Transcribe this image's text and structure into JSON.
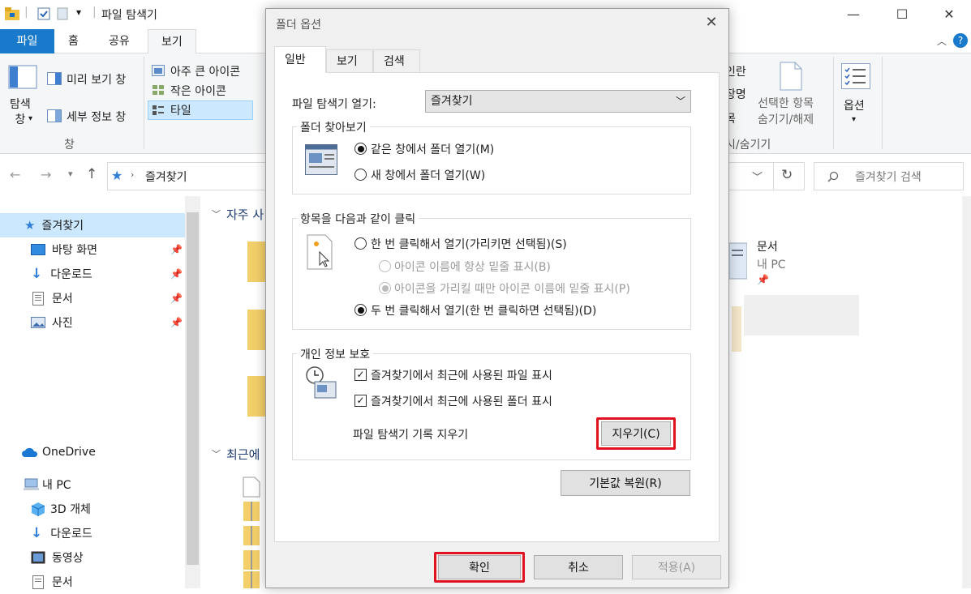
{
  "explorer": {
    "title": "파일 탐색기",
    "tabs": [
      "파일",
      "홈",
      "공유",
      "보기"
    ],
    "ribbon": {
      "nav_pane": "탐색\n창",
      "preview_pane": "미리 보기 창",
      "details_pane": "세부 정보 창",
      "pane_group": "창",
      "layout_xl": "아주 큰 아이콘",
      "layout_small": "작은 아이콘",
      "layout_tiles": "타일",
      "right_top": "인란",
      "right_mid": "장명",
      "right_bot": "목",
      "hide_selected": "선택한 항목\n숨기기/해제",
      "showhide_group": "시/숨기기",
      "options": "옵션"
    },
    "address": "즐겨찾기",
    "search_placeholder": "즐겨찾기 검색",
    "sidebar": [
      {
        "label": "즐겨찾기",
        "icon": "star-icon",
        "pinned": false
      },
      {
        "label": "바탕 화면",
        "icon": "desktop-icon",
        "pinned": true
      },
      {
        "label": "다운로드",
        "icon": "download-icon",
        "pinned": true
      },
      {
        "label": "문서",
        "icon": "document-icon",
        "pinned": true
      },
      {
        "label": "사진",
        "icon": "picture-icon",
        "pinned": true
      },
      {
        "label": "OneDrive",
        "icon": "cloud-icon",
        "pinned": false
      },
      {
        "label": "내 PC",
        "icon": "pc-icon",
        "pinned": false
      },
      {
        "label": "3D 개체",
        "icon": "cube-icon",
        "pinned": false
      },
      {
        "label": "다운로드",
        "icon": "download-icon",
        "pinned": false
      },
      {
        "label": "동영상",
        "icon": "video-icon",
        "pinned": false
      },
      {
        "label": "문서",
        "icon": "document-icon",
        "pinned": false
      }
    ],
    "content": {
      "section_frequent": "자주 사",
      "section_recent": "최근에",
      "doc_tile_name": "문서",
      "doc_tile_sub": "내 PC"
    }
  },
  "dialog": {
    "title": "폴더 옵션",
    "tabs": [
      "일반",
      "보기",
      "검색"
    ],
    "open_label": "파일 탐색기 열기:",
    "open_value": "즐겨찾기",
    "browse": {
      "label": "폴더 찾아보기",
      "same_window": "같은 창에서 폴더 열기(M)",
      "new_window": "새 창에서 폴더 열기(W)"
    },
    "click": {
      "label": "항목을 다음과 같이 클릭",
      "single": "한 번 클릭해서 열기(가리키면 선택됨)(S)",
      "underline_always": "아이콘 이름에 항상 밑줄 표시(B)",
      "underline_hover": "아이콘을 가리킬 때만 아이콘 이름에 밑줄 표시(P)",
      "double": "두 번 클릭해서 열기(한 번 클릭하면 선택됨)(D)"
    },
    "privacy": {
      "label": "개인 정보 보호",
      "recent_files": "즐겨찾기에서 최근에 사용된 파일 표시",
      "recent_folders": "즐겨찾기에서 최근에 사용된 폴더 표시",
      "clear_label": "파일 탐색기 기록 지우기",
      "clear_button": "지우기(C)"
    },
    "restore": "기본값 복원(R)",
    "ok": "확인",
    "cancel": "취소",
    "apply": "적용(A)"
  },
  "colors": {
    "accent": "#1979ca",
    "highlight": "#e1121f",
    "selection": "#cce8ff"
  }
}
